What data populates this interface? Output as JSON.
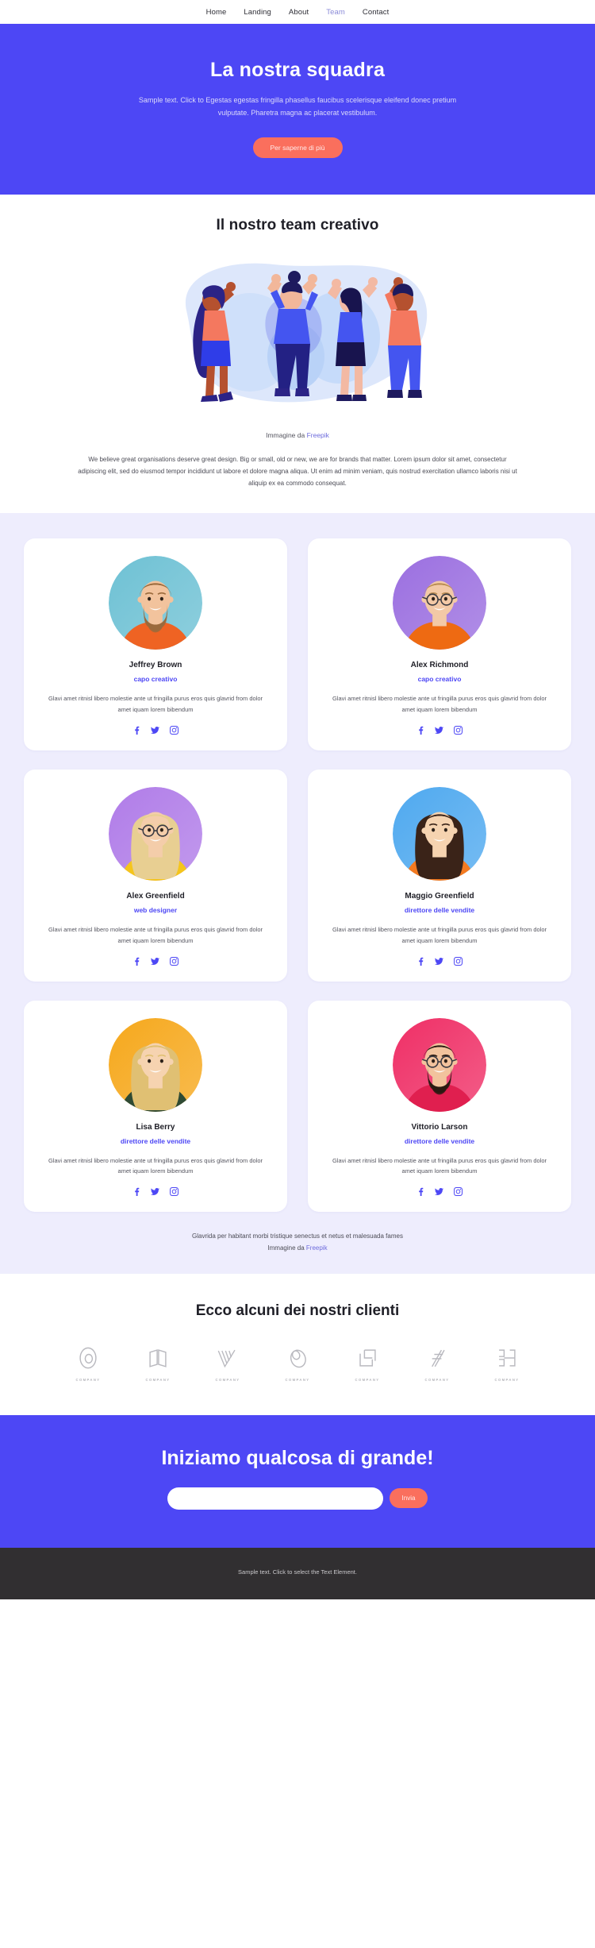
{
  "nav": {
    "items": [
      {
        "label": "Home",
        "active": false
      },
      {
        "label": "Landing",
        "active": false
      },
      {
        "label": "About",
        "active": false
      },
      {
        "label": "Team",
        "active": true
      },
      {
        "label": "Contact",
        "active": false
      }
    ]
  },
  "hero": {
    "title": "La nostra squadra",
    "subtitle": "Sample text. Click to Egestas egestas fringilla phasellus faucibus scelerisque eleifend donec pretium vulputate. Pharetra magna ac placerat vestibulum.",
    "button_label": "Per saperne di più",
    "background_color": "#4d47f5",
    "button_color": "#fa6f5d"
  },
  "creative": {
    "title": "Il nostro team creativo",
    "image_alt": "team-celebration-illustration",
    "caption_prefix": "Immagine da ",
    "caption_link": "Freepik",
    "body": "We believe great organisations deserve great design. Big or small, old or new, we are for brands that matter. Lorem ipsum dolor sit amet, consectetur adipiscing elit, sed do eiusmod tempor incididunt ut labore et dolore magna aliqua. Ut enim ad minim veniam, quis nostrud exercitation ullamco laboris nisi ut aliquip ex ea commodo consequat."
  },
  "team": {
    "background_color": "#eeedfd",
    "role_color": "#4d47f5",
    "description": "Glavi amet ritnisl libero molestie ante ut fringilla purus eros quis glavrid from dolor amet iquam lorem bibendum",
    "socials": [
      "facebook-icon",
      "twitter-icon",
      "instagram-icon"
    ],
    "members": [
      {
        "name": "Jeffrey Brown",
        "role": "capo creativo",
        "description": "Glavi amet ritnisl libero molestie ante ut fringilla purus eros quis glavrid from dolor amet iquam lorem bibendum",
        "bg_color": "#6ec1d4",
        "shirt_color": "#ef6323",
        "skin_color": "#f2c39d",
        "hair_color": "#9a6a3c",
        "beard": true,
        "glasses": false,
        "hair_long": false
      },
      {
        "name": "Alex Richmond",
        "role": "capo creativo",
        "description": "Glavi amet ritnisl libero molestie ante ut fringilla purus eros quis glavrid from dolor amet iquam lorem bibendum",
        "bg_color": "#9b6fe0",
        "shirt_color": "#ee6a12",
        "skin_color": "#f3c9a6",
        "hair_color": "#b98c52",
        "beard": false,
        "glasses": true,
        "hair_long": false
      },
      {
        "name": "Alex Greenfield",
        "role": "web designer",
        "description": "Glavi amet ritnisl libero molestie ante ut fringilla purus eros quis glavrid from dolor amet iquam lorem bibendum",
        "bg_color": "#b07ce8",
        "shirt_color": "#f5c51c",
        "skin_color": "#f4cdaa",
        "hair_color": "#e8cf92",
        "beard": false,
        "glasses": true,
        "hair_long": true
      },
      {
        "name": "Maggio Greenfield",
        "role": "direttore delle vendite",
        "description": "Glavi amet ritnisl libero molestie ante ut fringilla purus eros quis glavrid from dolor amet iquam lorem bibendum",
        "bg_color": "#4fa9ef",
        "shirt_color": "#f47a20",
        "skin_color": "#f6d3b0",
        "hair_color": "#3a2318",
        "beard": false,
        "glasses": false,
        "hair_long": true
      },
      {
        "name": "Lisa Berry",
        "role": "direttore delle vendite",
        "description": "Glavi amet ritnisl libero molestie ante ut fringilla purus eros quis glavrid from dolor amet iquam lorem bibendum",
        "bg_color": "#f6a81c",
        "shirt_color": "#2f4a33",
        "skin_color": "#f6d3b0",
        "hair_color": "#e0c073",
        "beard": false,
        "glasses": false,
        "hair_long": true
      },
      {
        "name": "Vittorio Larson",
        "role": "direttore delle vendite",
        "description": "Glavi amet ritnisl libero molestie ante ut fringilla purus eros quis glavrid from dolor amet iquam lorem bibendum",
        "bg_color": "#ef2f66",
        "shirt_color": "#e01f4f",
        "skin_color": "#f2c39d",
        "hair_color": "#2b1a12",
        "beard": true,
        "glasses": true,
        "hair_long": false
      }
    ],
    "footnote_line1": "Glavrida per habitant morbi tristique senectus et netus et malesuada fames",
    "footnote_prefix": "Immagine da ",
    "footnote_link": "Freepik"
  },
  "clients": {
    "title": "Ecco alcuni dei nostri clienti",
    "logos": [
      {
        "icon": "ring-logo-icon",
        "label": "COMPANY"
      },
      {
        "icon": "book-logo-icon",
        "label": "COMPANY"
      },
      {
        "icon": "chevron-lines-logo-icon",
        "label": "COMPANY"
      },
      {
        "icon": "oval-swirl-logo-icon",
        "label": "COMPANY"
      },
      {
        "icon": "corner-square-logo-icon",
        "label": "COMPANY"
      },
      {
        "icon": "slash-lines-logo-icon",
        "label": "COMPANY"
      },
      {
        "icon": "bracket-blocks-logo-icon",
        "label": "COMPANY"
      }
    ]
  },
  "cta": {
    "title": "Iniziamo qualcosa di grande!",
    "input_value": "",
    "input_placeholder": "",
    "submit_label": "Invia"
  },
  "footer": {
    "text": "Sample text. Click to select the Text Element.",
    "background_color": "#312f31"
  }
}
